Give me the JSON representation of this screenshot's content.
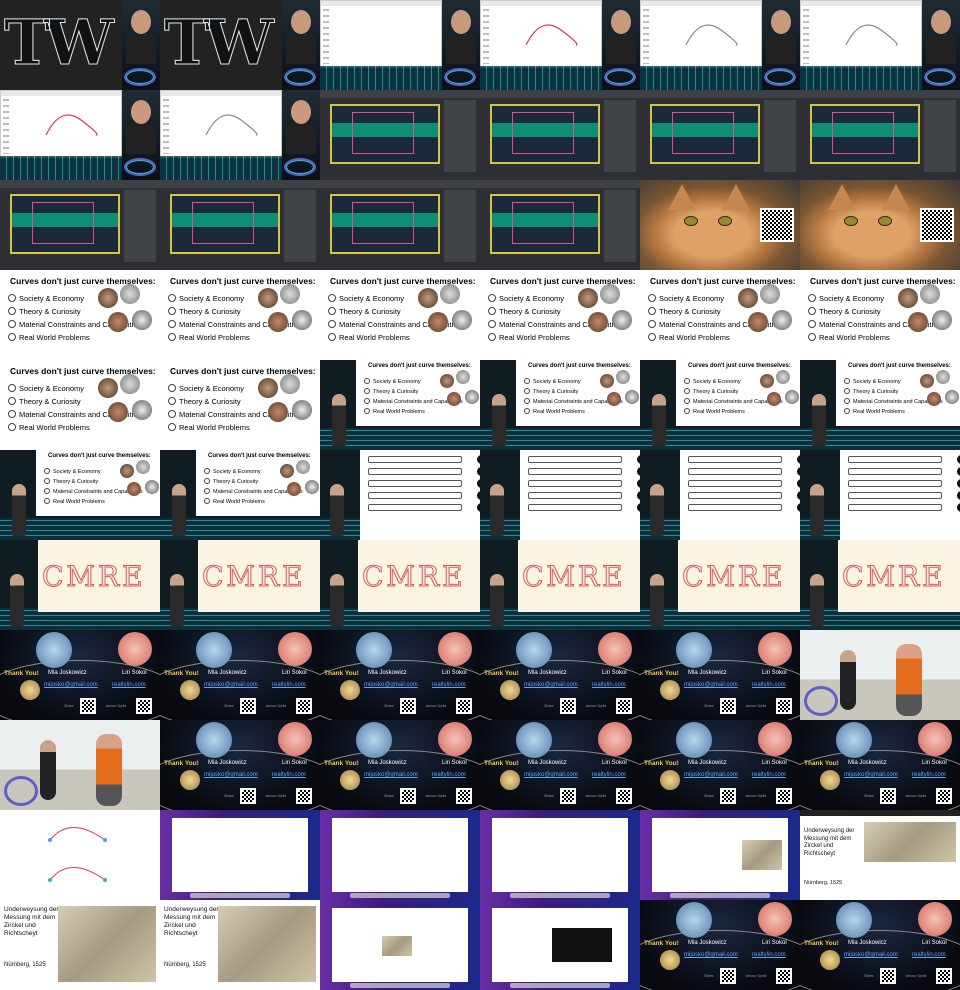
{
  "grid": {
    "columns": 6,
    "rows": 11
  },
  "text": {
    "curves_title": "Curves don't just curve themselves:",
    "items": [
      "Society & Economy",
      "Theory & Curiosity",
      "Material Constraints and Capabilities",
      "Real World Problems"
    ],
    "thank_you": "Thank You!",
    "name_1": "Mia Joskowicz",
    "name_2": "Liri Sokol",
    "email_1": "mijosko@gmail.com",
    "email_2": "realtylin.com",
    "slides_label": "Slides",
    "sponsor_label": "Amour Sprite",
    "durer_title": "Underweysung der Messung mit dem Zirckel und Richtscheyt",
    "durer_place": "Nürnberg, 1525",
    "curve_word": "CMRE"
  },
  "colors": {
    "accent_teal": "#19a4b6",
    "slide_bg": "#ffffff",
    "link_blue": "#58a8ff",
    "gold": "#f3c84b"
  }
}
